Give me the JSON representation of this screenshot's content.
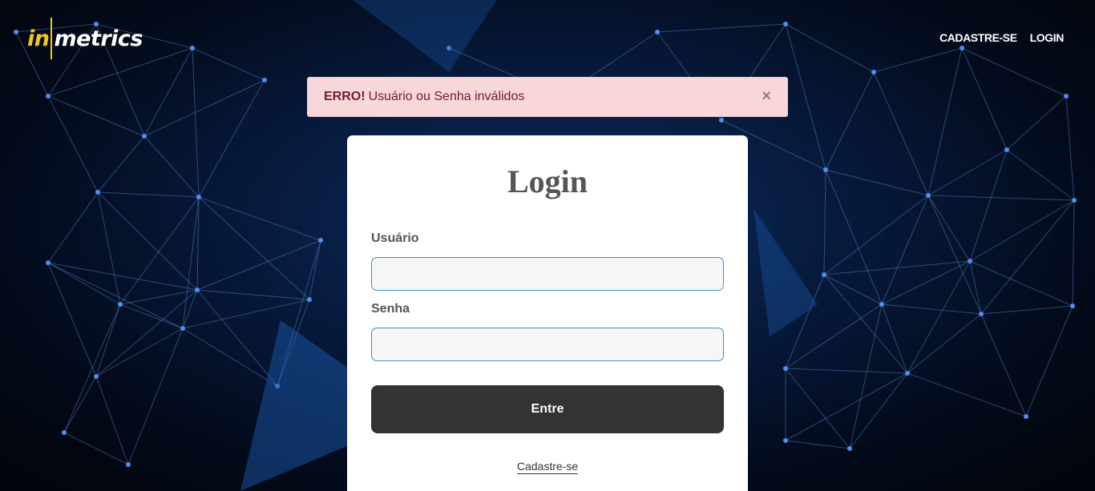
{
  "brand": {
    "logo_in": "in",
    "logo_metrics": "metrics",
    "accent": "#f5c518"
  },
  "nav": {
    "register": "CADASTRE-SE",
    "login": "LOGIN"
  },
  "alert": {
    "title": "ERRO!",
    "message": "Usuário ou Senha inválidos",
    "close": "×",
    "background": "#f8d7da",
    "text_color": "#721c24"
  },
  "login_form": {
    "title": "Login",
    "username_label": "Usuário",
    "username_value": "",
    "password_label": "Senha",
    "password_value": "",
    "submit_label": "Entre",
    "register_link": "Cadastre-se",
    "input_border_color": "#3a93cf",
    "button_color": "#333333"
  }
}
